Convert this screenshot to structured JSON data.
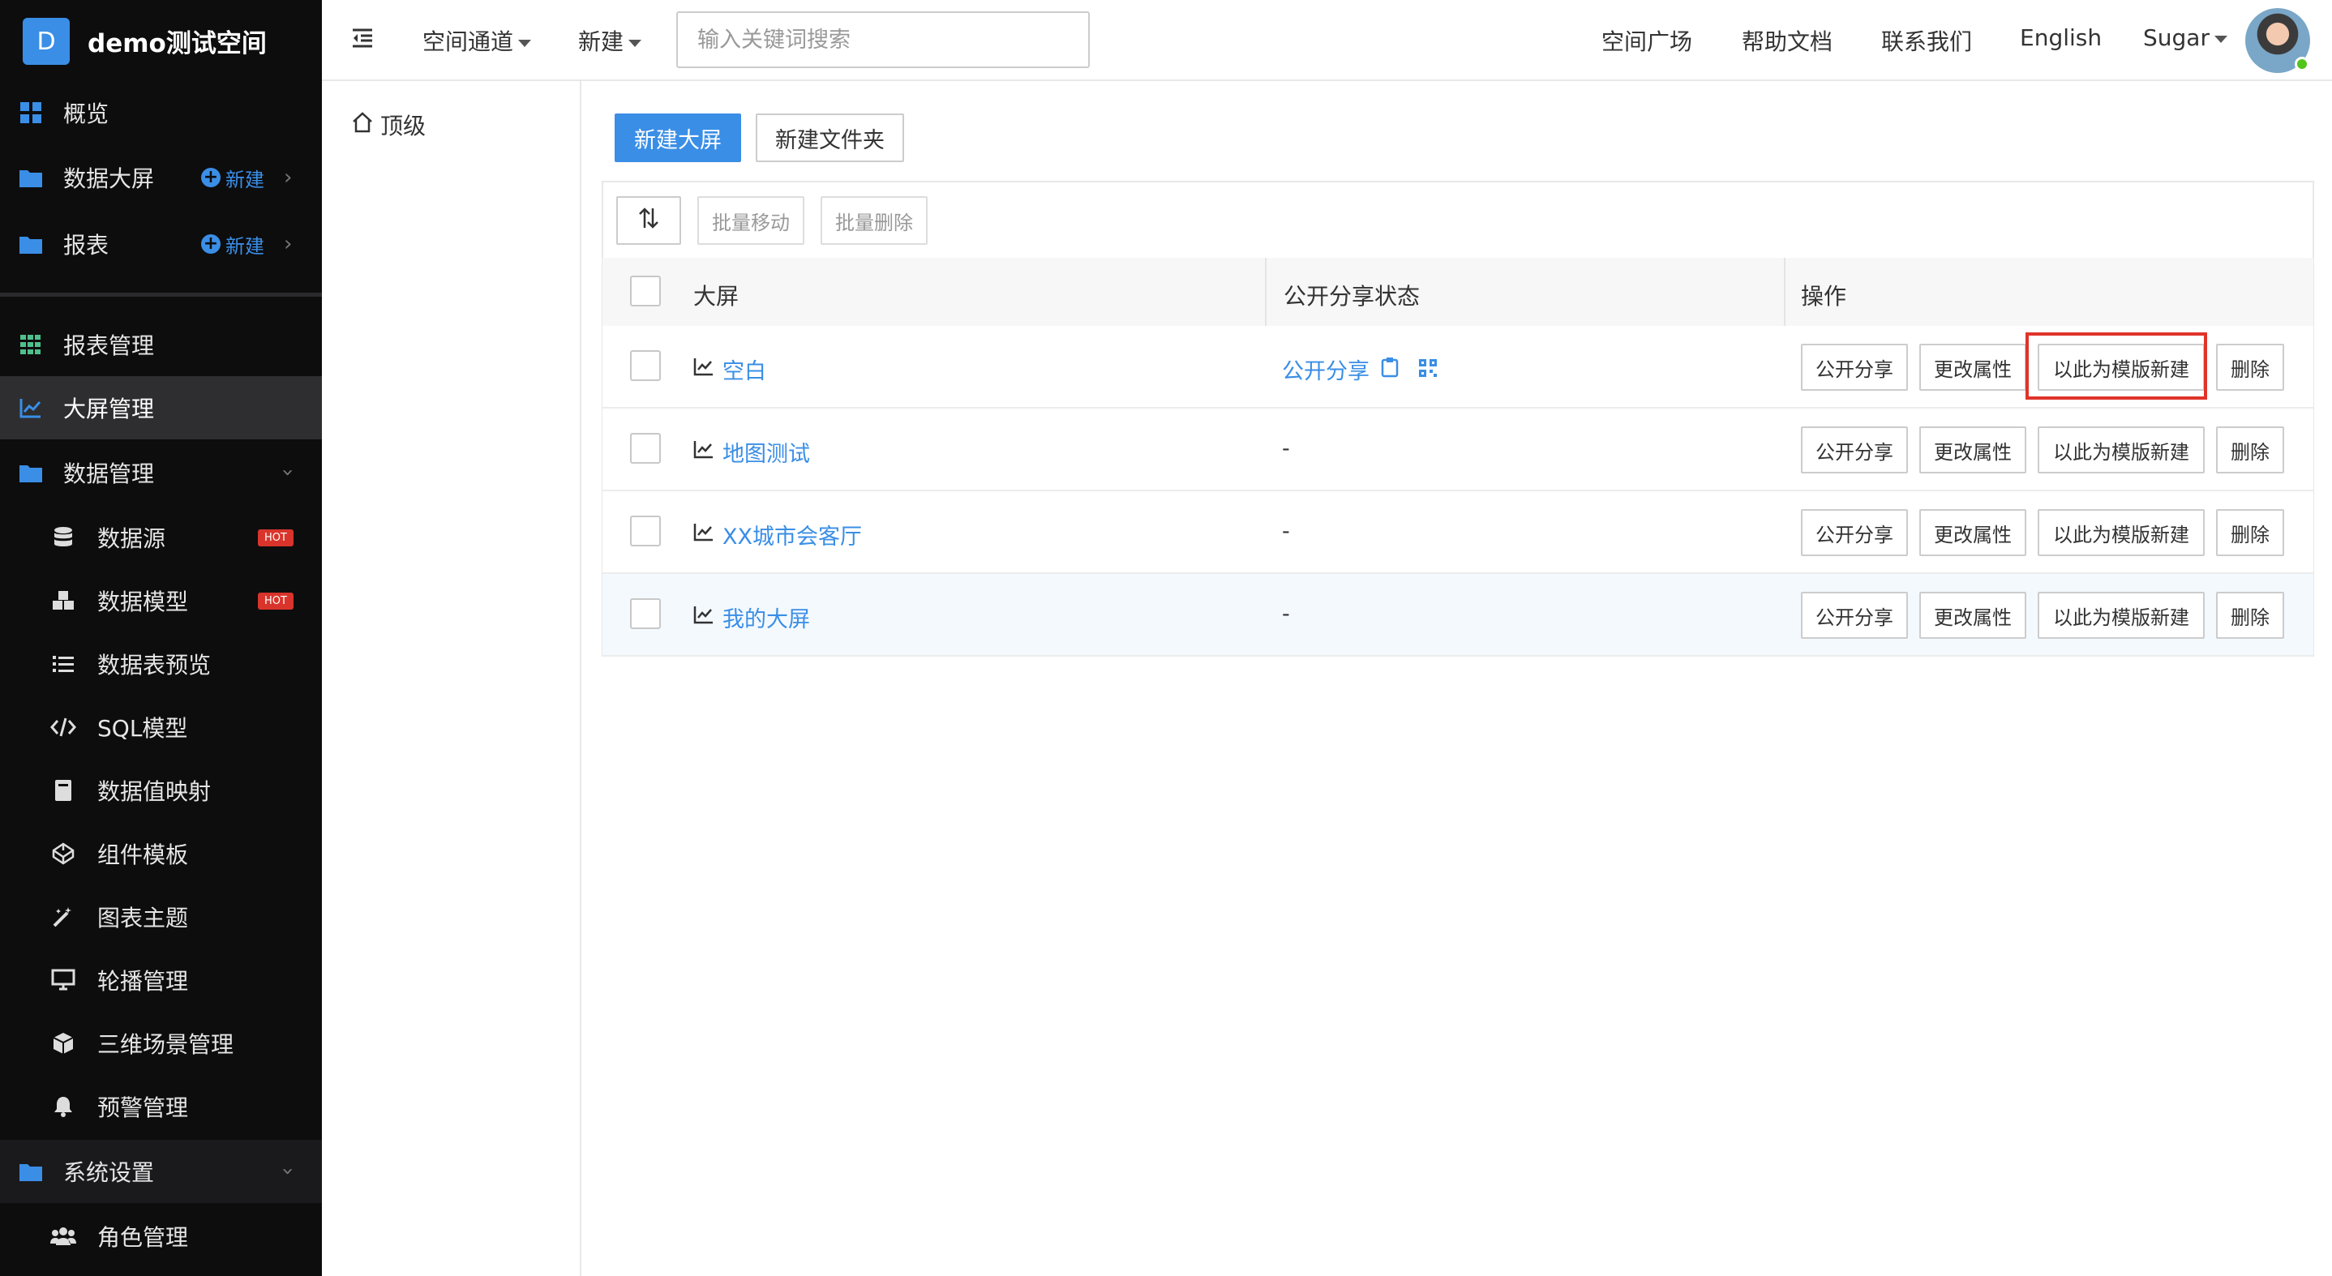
{
  "sidebar": {
    "logo_letter": "D",
    "title": "demo测试空间",
    "items": [
      {
        "label": "概览"
      },
      {
        "label": "数据大屏",
        "new_label": "新建"
      },
      {
        "label": "报表",
        "new_label": "新建"
      },
      {
        "label": "报表管理"
      },
      {
        "label": "大屏管理"
      },
      {
        "label": "数据管理"
      },
      {
        "label": "数据源",
        "badge": "HOT"
      },
      {
        "label": "数据模型",
        "badge": "HOT"
      },
      {
        "label": "数据表预览"
      },
      {
        "label": "SQL模型"
      },
      {
        "label": "数据值映射"
      },
      {
        "label": "组件模板"
      },
      {
        "label": "图表主题"
      },
      {
        "label": "轮播管理"
      },
      {
        "label": "三维场景管理"
      },
      {
        "label": "预警管理"
      },
      {
        "label": "系统设置"
      },
      {
        "label": "角色管理"
      }
    ]
  },
  "header": {
    "space_channel": "空间通道",
    "new": "新建",
    "search_placeholder": "输入关键词搜索",
    "links": [
      "空间广场",
      "帮助文档",
      "联系我们",
      "English"
    ],
    "user": "Sugar"
  },
  "tree": {
    "root": "顶级"
  },
  "toolbar": {
    "new_screen": "新建大屏",
    "new_folder": "新建文件夹",
    "batch_move": "批量移动",
    "batch_delete": "批量删除"
  },
  "table": {
    "headers": [
      "大屏",
      "公开分享状态",
      "操作"
    ],
    "actions": [
      "公开分享",
      "更改属性",
      "以此为模版新建",
      "删除"
    ],
    "rows": [
      {
        "name": "空白",
        "share": "公开分享"
      },
      {
        "name": "地图测试",
        "share": "-"
      },
      {
        "name": "XX城市会客厅",
        "share": "-"
      },
      {
        "name": "我的大屏",
        "share": "-"
      }
    ]
  },
  "colors": {
    "accent": "#3a8ee6",
    "sidebar": "#0d0d0e",
    "hot": "#d9342b",
    "highlight": "#e0342a"
  }
}
